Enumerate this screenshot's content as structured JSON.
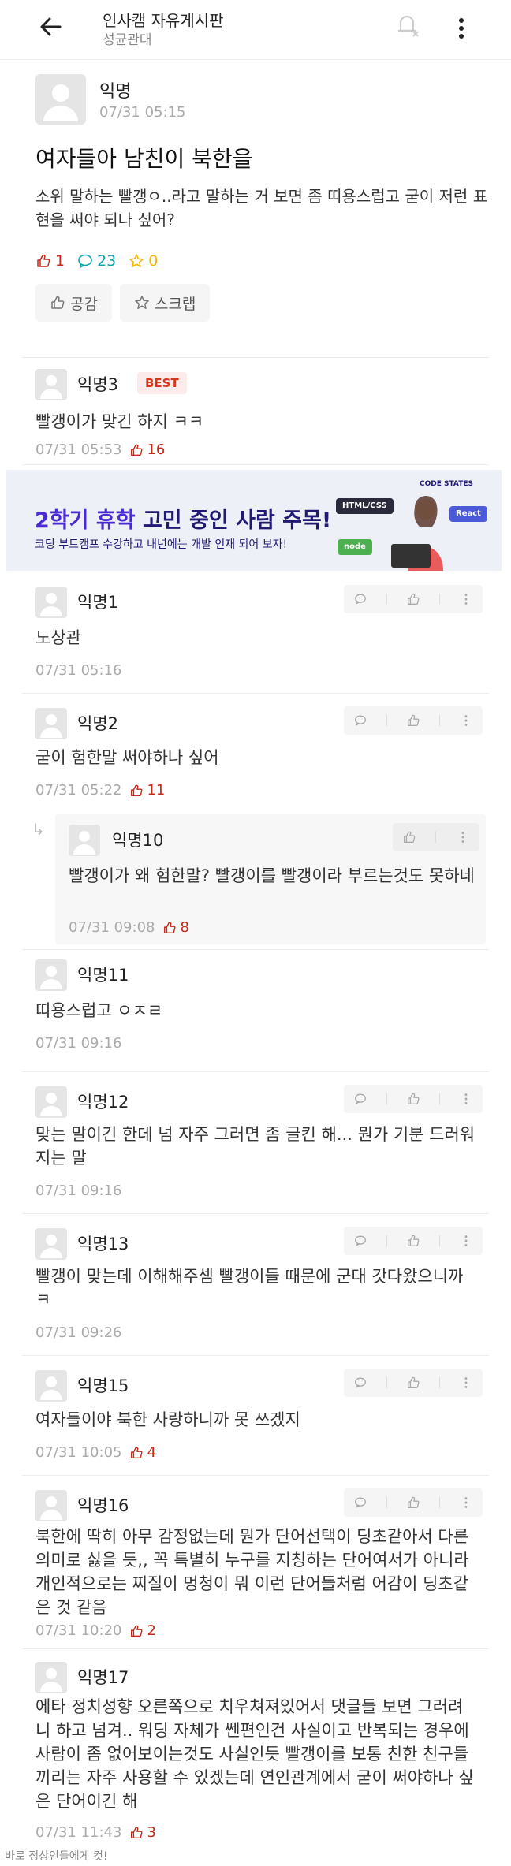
{
  "header": {
    "title": "인사캠 자유게시판",
    "subtitle": "성균관대"
  },
  "post": {
    "author": "익명",
    "time": "07/31 05:15",
    "title": "여자들아 남친이 북한을",
    "body": "소위 말하는 빨갱ㅇ..라고 말하는 거 보면 좀 띠용스럽고 굳이 저런 표현을 써야 되나 싶어?",
    "likes": "1",
    "comments": "23",
    "scraps": "0",
    "like_label": "공감",
    "scrap_label": "스크랩"
  },
  "ad": {
    "main_part1": "2학기 휴학",
    "main_part2": " 고민 중인 사람 주목!",
    "sub": "코딩 부트캠프 수강하고 내년에는 개발 인재 되어 보자!",
    "logo": "CODE STATES",
    "tag_html": "HTML/CSS",
    "tag_node": "node",
    "tag_react": "React"
  },
  "comments": [
    {
      "author": "익명3",
      "badge": "BEST",
      "text": "빨갱이가 맞긴 하지 ㅋㅋ",
      "time": "07/31 05:53",
      "likes": "16"
    },
    {
      "author": "익명1",
      "text": "노상관",
      "time": "07/31 05:16"
    },
    {
      "author": "익명2",
      "text": "굳이 험한말 써야하나 싶어",
      "time": "07/31 05:22",
      "likes": "11"
    },
    {
      "author": "익명10",
      "text": "빨갱이가 왜 험한말? 빨갱이를 빨갱이라 부르는것도 못하네",
      "time": "07/31 09:08",
      "likes": "8"
    },
    {
      "author": "익명11",
      "text": "띠용스럽고 ㅇㅈㄹ",
      "time": "07/31 09:16"
    },
    {
      "author": "익명12",
      "text": "맞는 말이긴 한데 넘 자주 그러면 좀 글킨 해... 뭔가 기분 드러워지는 말",
      "time": "07/31 09:16"
    },
    {
      "author": "익명13",
      "text": "빨갱이 맞는데 이해해주셈 빨갱이들 때문에 군대 갓다왔으니까ㅋ",
      "time": "07/31 09:26"
    },
    {
      "author": "익명15",
      "text": "여자들이야 북한 사랑하니까 못 쓰겠지",
      "time": "07/31 10:05",
      "likes": "4"
    },
    {
      "author": "익명16",
      "text": "북한에 딱히 아무 감정없는데 뭔가 단어선택이 딩초같아서 다른 의미로 싫을 듯,, 꼭 특별히 누구를 지칭하는 단어여서가 아니라 개인적으로는 찌질이 멍청이 뭐 이런 단어들처럼 어감이 딩초같은 것 같음",
      "time": "07/31 10:20",
      "likes": "2"
    },
    {
      "author": "익명17",
      "text": "에타 정치성향 오른쪽으로 치우쳐져있어서 댓글들 보면 그러려니 하고 넘겨.. 워딩 자체가 쎈편인건 사실이고 반복되는 경우에 사람이 좀 없어보이는것도 사실인듯 빨갱이를 보통 친한 친구들끼리는 자주 사용할 수 있겠는데 연인관계에서 굳이 써야하나 싶은 단어이긴 해",
      "time": "07/31 11:43",
      "likes": "3"
    }
  ],
  "footer": "바로 정상인들에게 컷!"
}
